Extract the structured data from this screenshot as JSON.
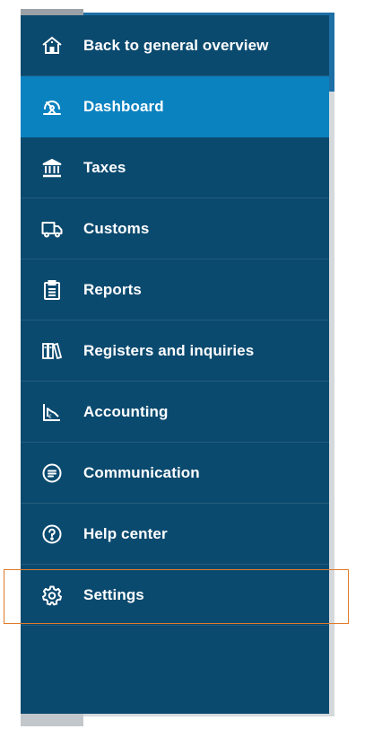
{
  "colors": {
    "sidebar_bg": "#0b4a6f",
    "active_bg": "#0a82bf",
    "highlight_border": "#e07b2a"
  },
  "nav": {
    "items": [
      {
        "label": "Back to general overview",
        "icon": "home-icon",
        "active": false
      },
      {
        "label": "Dashboard",
        "icon": "dashboard-gauge-icon",
        "active": true
      },
      {
        "label": "Taxes",
        "icon": "bank-building-icon",
        "active": false
      },
      {
        "label": "Customs",
        "icon": "truck-icon",
        "active": false
      },
      {
        "label": "Reports",
        "icon": "clipboard-report-icon",
        "active": false
      },
      {
        "label": "Registers and inquiries",
        "icon": "registers-binders-icon",
        "active": false
      },
      {
        "label": "Accounting",
        "icon": "accounting-chart-icon",
        "active": false
      },
      {
        "label": "Communication",
        "icon": "chat-bubble-icon",
        "active": false
      },
      {
        "label": "Help center",
        "icon": "help-question-icon",
        "active": false
      },
      {
        "label": "Settings",
        "icon": "gear-icon",
        "active": false,
        "highlighted": true
      }
    ]
  }
}
